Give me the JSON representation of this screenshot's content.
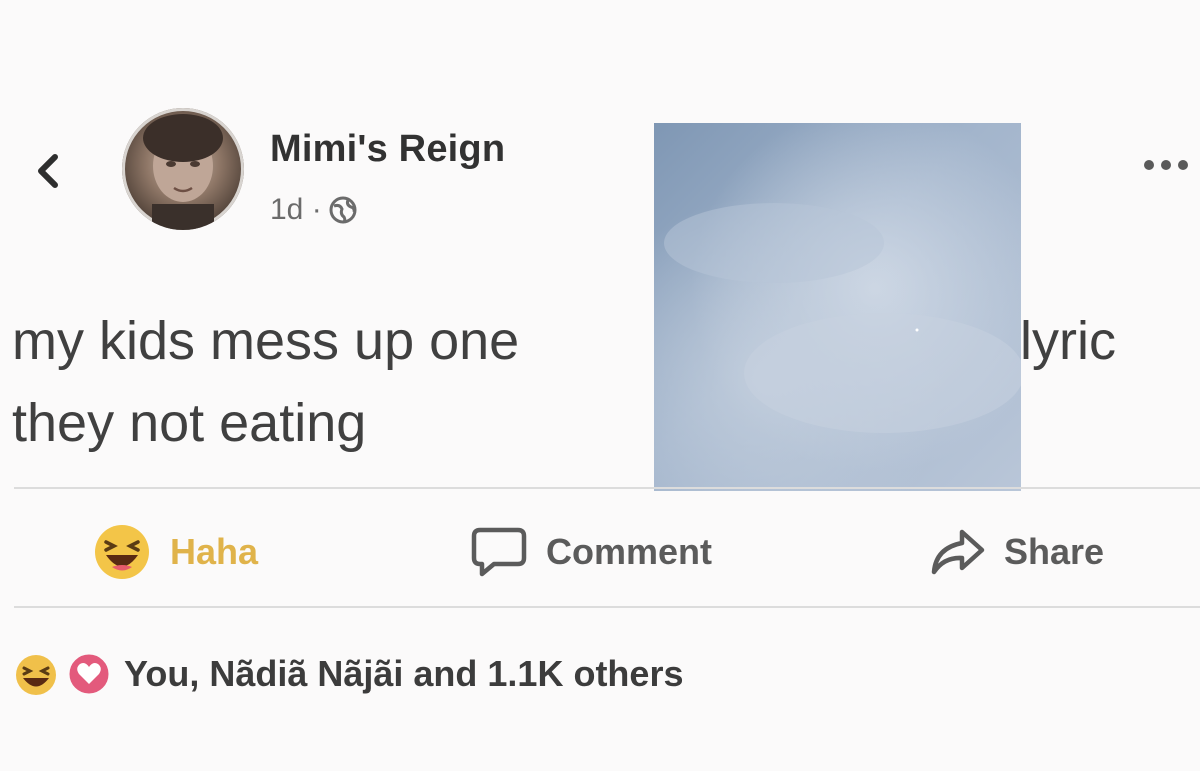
{
  "post": {
    "author": "Mimi's Reign",
    "timestamp": "1d ·",
    "privacy_icon": "globe-icon",
    "text_line1_start": "my kids mess up one",
    "text_line1_end": "lyric",
    "text_line2": "they not eating"
  },
  "actions": {
    "haha_label": "Haha",
    "comment_label": "Comment",
    "share_label": "Share"
  },
  "reactions": {
    "summary": "You, Nãdiã Nãjãi and 1.1K others",
    "icons": [
      "haha-reaction-icon",
      "love-reaction-icon"
    ]
  },
  "colors": {
    "haha_accent": "#e0b34a",
    "love_red": "#e0245e",
    "sky_blue": "#9fb3cc"
  }
}
